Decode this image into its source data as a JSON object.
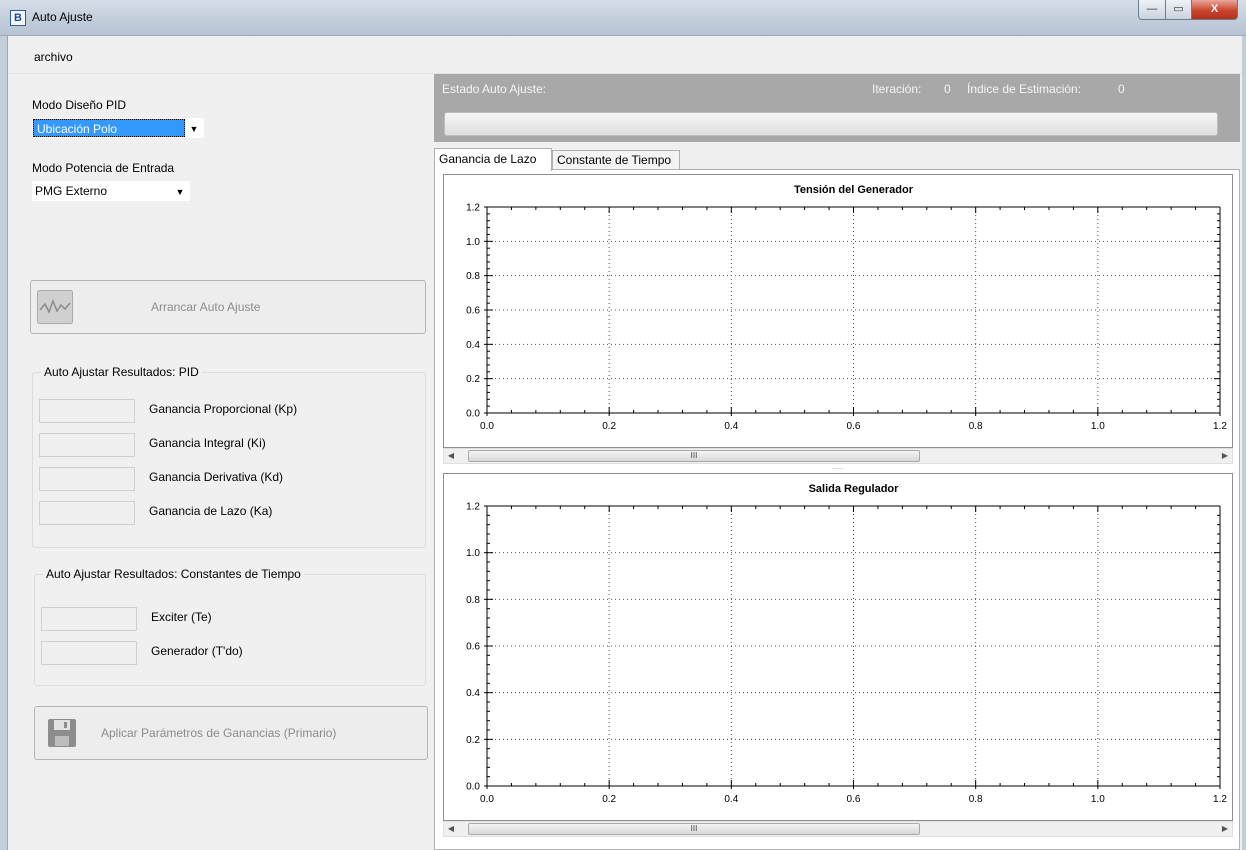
{
  "window": {
    "title": "Auto Ajuste",
    "min_glyph": "—",
    "max_glyph": "▭",
    "close_glyph": "X",
    "app_icon_glyph": "B"
  },
  "menu": {
    "items": [
      "archivo"
    ]
  },
  "left": {
    "pid_mode_label": "Modo Diseño PID",
    "pid_mode_value": "Ubicación Polo",
    "input_power_label": "Modo Potencia de Entrada",
    "input_power_value": "PMG Externo",
    "start_button": "Arrancar Auto Ajuste",
    "pid_results": {
      "title": "Auto Ajustar Resultados: PID",
      "rows": [
        {
          "label": "Ganancia Proporcional (Kp)",
          "value": ""
        },
        {
          "label": "Ganancia Integral (Ki)",
          "value": ""
        },
        {
          "label": "Ganancia Derivativa (Kd)",
          "value": ""
        },
        {
          "label": "Ganancia de Lazo (Ka)",
          "value": ""
        }
      ]
    },
    "tc_results": {
      "title": "Auto Ajustar Resultados: Constantes de Tiempo",
      "rows": [
        {
          "label": "Exciter (Te)",
          "value": ""
        },
        {
          "label": "Generador (T'do)",
          "value": ""
        }
      ]
    },
    "apply_button": "Aplicar Parámetros de Ganancias (Primario)"
  },
  "status": {
    "estado_label": "Estado Auto Ajuste:",
    "iteracion_label": "Iteración:",
    "iteracion_value": "0",
    "indice_label": "Índice de Estimación:",
    "indice_value": "0",
    "progress": 0
  },
  "tabs": [
    {
      "label": "Ganancia de Lazo",
      "active": true
    },
    {
      "label": "Constante de Tiempo",
      "active": false
    }
  ],
  "scroll": {
    "thumb_glyph": "III",
    "splitter_glyph": "......"
  },
  "chart_data": [
    {
      "type": "line",
      "title": "Tensión del Generador",
      "xlim": [
        0.0,
        1.2
      ],
      "ylim": [
        0.0,
        1.2
      ],
      "xticks": [
        "0.0",
        "0.2",
        "0.4",
        "0.6",
        "0.8",
        "1.0",
        "1.2"
      ],
      "yticks": [
        "0.0",
        "0.2",
        "0.4",
        "0.6",
        "0.8",
        "1.0",
        "1.2"
      ],
      "grid": true,
      "series": []
    },
    {
      "type": "line",
      "title": "Salida Regulador",
      "xlim": [
        0.0,
        1.2
      ],
      "ylim": [
        0.0,
        1.2
      ],
      "xticks": [
        "0.0",
        "0.2",
        "0.4",
        "0.6",
        "0.8",
        "1.0",
        "1.2"
      ],
      "yticks": [
        "0.0",
        "0.2",
        "0.4",
        "0.6",
        "0.8",
        "1.0",
        "1.2"
      ],
      "grid": true,
      "series": []
    }
  ]
}
